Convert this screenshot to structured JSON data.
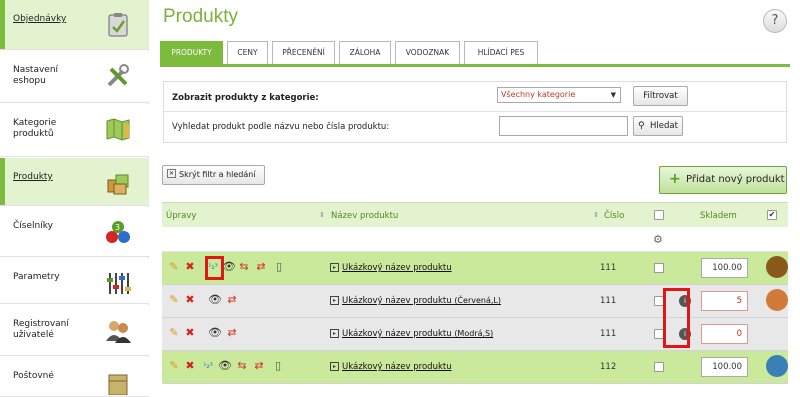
{
  "sidebar": {
    "items": [
      {
        "label": "Objednávky",
        "icon": "clipboard-icon"
      },
      {
        "label": "Nastavení eshopu",
        "icon": "tools-icon"
      },
      {
        "label": "Kategorie produktů",
        "icon": "map-icon"
      },
      {
        "label": "Produkty",
        "icon": "boxes-icon"
      },
      {
        "label": "Číselníky",
        "icon": "numbers-icon"
      },
      {
        "label": "Parametry",
        "icon": "sliders-icon"
      },
      {
        "label": "Registrovaní uživatelé",
        "icon": "users-icon"
      },
      {
        "label": "Poštovné",
        "icon": "shipping-icon"
      }
    ]
  },
  "header": {
    "title": "Produkty",
    "help": "?"
  },
  "tabs": [
    "PRODUKTY",
    "CENY",
    "PŘECENĚNÍ",
    "ZÁLOHA",
    "VODOZNAK",
    "HLÍDACÍ PES"
  ],
  "filter": {
    "category_label": "Zobrazit produkty z kategorie:",
    "category_value": "Všechny kategorie",
    "filter_button": "Filtrovat",
    "search_label": "Vyhledat produkt podle názvu nebo čísla produktu:",
    "search_value": "",
    "search_button": "Hledat"
  },
  "toolbar": {
    "hide_filter": "Skrýt filtr a hledání",
    "add_product": "Přidat nový produkt"
  },
  "table": {
    "columns": {
      "actions": "Úpravy",
      "name": "Název produktu",
      "number": "Číslo",
      "stock": "Skladem"
    },
    "rows": [
      {
        "name": "Ukázkový název produktu",
        "variant": "",
        "number": "111",
        "stock": "100.00",
        "style": "green",
        "thumb": "#8a5a1c"
      },
      {
        "name": "Ukázkový název produktu",
        "variant": "(Červená,L)",
        "number": "111",
        "stock": "5",
        "style": "gray",
        "thumb": "#d27a3a"
      },
      {
        "name": "Ukázkový název produktu",
        "variant": "(Modrá,S)",
        "number": "111",
        "stock": "0",
        "style": "gray",
        "thumb": ""
      },
      {
        "name": "Ukázkový název produktu",
        "variant": "",
        "number": "112",
        "stock": "100.00",
        "style": "green",
        "thumb": "#3a7fb5"
      }
    ]
  },
  "colors": {
    "accent": "#7cbb3c",
    "highlight": "#e01717",
    "row_green": "#cbe99b"
  }
}
